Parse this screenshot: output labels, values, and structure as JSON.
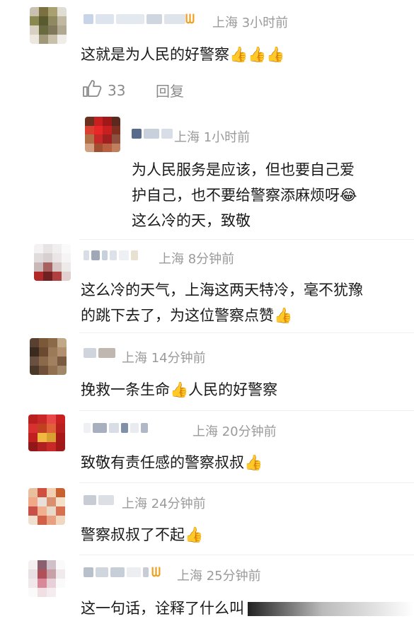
{
  "comments": [
    {
      "location": "上海",
      "time": "3小时前",
      "text": "这就是为人民的好警察👍👍👍",
      "likes": "33",
      "reply_label": "回复",
      "has_vip_badge": true,
      "replies": [
        {
          "location": "上海",
          "time": "1小时前",
          "text": "为人民服务是应该，但也要自己爱护自己，也不要给警察添麻烦呀😂这么冷的天，致敬"
        }
      ]
    },
    {
      "location": "上海",
      "time": "8分钟前",
      "text": "这么冷的天气，上海这两天特冷，毫不犹豫的跳下去了，为这位警察点赞👍"
    },
    {
      "location": "上海",
      "time": "14分钟前",
      "text": "挽救一条生命👍人民的好警察"
    },
    {
      "location": "上海",
      "time": "20分钟前",
      "text": "致敬有责任感的警察叔叔👍"
    },
    {
      "location": "上海",
      "time": "24分钟前",
      "text": "警察叔叔了不起👍"
    },
    {
      "location": "上海",
      "time": "25分钟前",
      "text": "这一句话，诠释了什么叫",
      "has_vip_badge": true
    }
  ],
  "icons": {
    "like": "thumbs-up-outline-icon",
    "vip": "vip-badge-icon"
  },
  "colors": {
    "meta": "#9a9a9a",
    "text": "#1a1a1a",
    "vip": "#f0a020"
  }
}
